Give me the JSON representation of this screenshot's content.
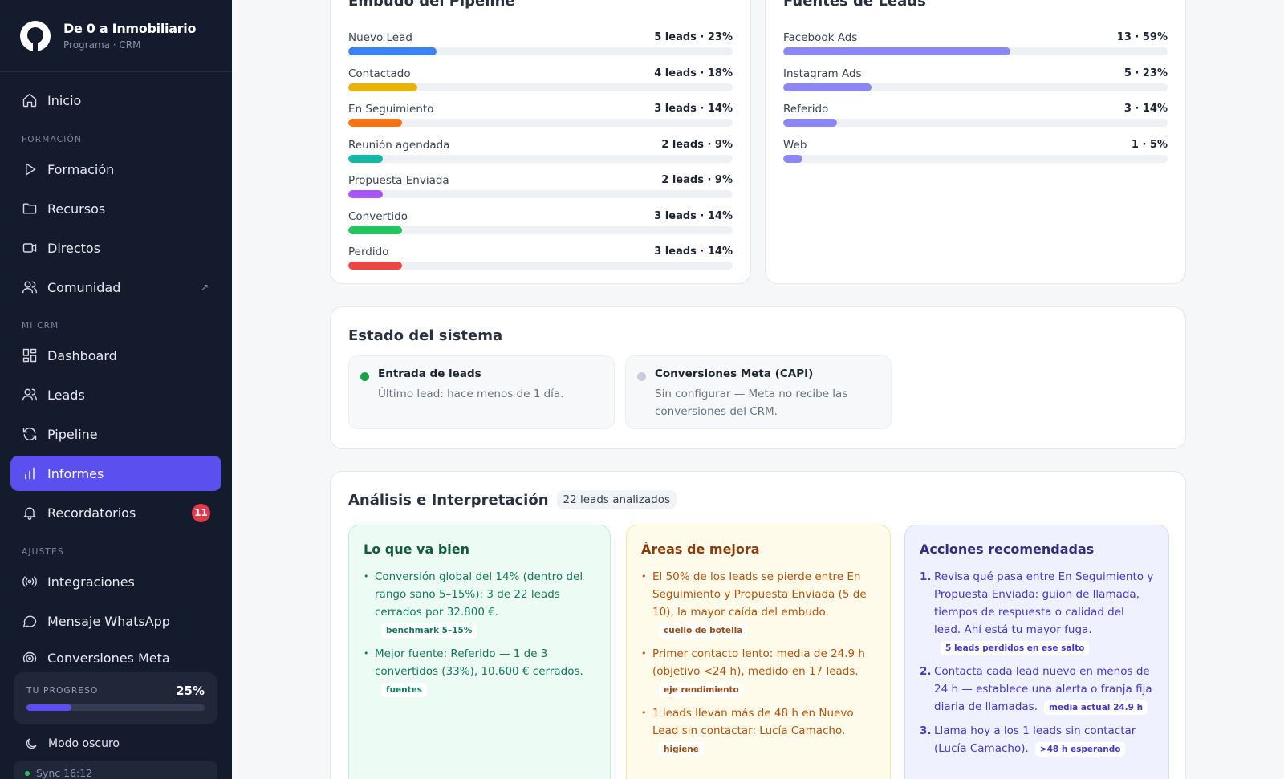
{
  "brand": {
    "title": "De 0 a Inmobiliario",
    "subtitle": "Programa · CRM"
  },
  "sidebar": {
    "home": "Inicio",
    "section_formacion": "FORMACIÓN",
    "formacion": "Formación",
    "recursos": "Recursos",
    "directos": "Directos",
    "comunidad": "Comunidad",
    "section_crm": "MI CRM",
    "dashboard": "Dashboard",
    "leads": "Leads",
    "pipeline": "Pipeline",
    "informes": "Informes",
    "recordatorios": "Recordatorios",
    "recordatorios_badge": "11",
    "section_ajustes": "AJUSTES",
    "integraciones": "Integraciones",
    "whatsapp": "Mensaje WhatsApp",
    "conversiones_meta": "Conversiones Meta"
  },
  "progress": {
    "label": "TU PROGRESO",
    "value": "25%",
    "fraction": 0.25
  },
  "dark_mode": "Modo oscuro",
  "sync": "Sync 16:12",
  "pipeline_card": {
    "title": "Embudo del Pipeline",
    "rows": [
      {
        "label": "Nuevo Lead",
        "value": "5 leads · 23%",
        "pct": 23,
        "color": "#3b82f6"
      },
      {
        "label": "Contactado",
        "value": "4 leads · 18%",
        "pct": 18,
        "color": "#eab308"
      },
      {
        "label": "En Seguimiento",
        "value": "3 leads · 14%",
        "pct": 14,
        "color": "#f97316"
      },
      {
        "label": "Reunión agendada",
        "value": "2 leads · 9%",
        "pct": 9,
        "color": "#14b8a6"
      },
      {
        "label": "Propuesta Enviada",
        "value": "2 leads · 9%",
        "pct": 9,
        "color": "#a855f7"
      },
      {
        "label": "Convertido",
        "value": "3 leads · 14%",
        "pct": 14,
        "color": "#22c55e"
      },
      {
        "label": "Perdido",
        "value": "3 leads · 14%",
        "pct": 14,
        "color": "#ef4444"
      }
    ]
  },
  "sources_card": {
    "title": "Fuentes de Leads",
    "rows": [
      {
        "label": "Facebook Ads",
        "value": "13 · 59%",
        "pct": 59,
        "color": "#8b87f5"
      },
      {
        "label": "Instagram Ads",
        "value": "5 · 23%",
        "pct": 23,
        "color": "#8b87f5"
      },
      {
        "label": "Referido",
        "value": "3 · 14%",
        "pct": 14,
        "color": "#8b87f5"
      },
      {
        "label": "Web",
        "value": "1 · 5%",
        "pct": 5,
        "color": "#8b87f5"
      }
    ]
  },
  "system": {
    "title": "Estado del sistema",
    "items": [
      {
        "title": "Entrada de leads",
        "desc": "Último lead: hace menos de 1 día.",
        "dot_color": "#16a34a"
      },
      {
        "title": "Conversiones Meta (CAPI)",
        "desc": "Sin configurar — Meta no recibe las conversiones del CRM.",
        "dot_color": "#c8cdd6"
      }
    ]
  },
  "analysis": {
    "title": "Análisis e Interpretación",
    "pill": "22 leads analizados",
    "good": {
      "title": "Lo que va bien",
      "items": [
        {
          "text": "Conversión global del 14% (dentro del rango sano 5–15%): 3 de 22 leads cerrados por 32.800 €.",
          "tag": "benchmark 5–15%"
        },
        {
          "text": "Mejor fuente: Referido — 1 de 3 convertidos (33%), 10.600 € cerrados.",
          "tag": "fuentes"
        }
      ]
    },
    "improve": {
      "title": "Áreas de mejora",
      "items": [
        {
          "text": "El 50% de los leads se pierde entre En Seguimiento y Propuesta Enviada (5 de 10), la mayor caída del embudo.",
          "tag": "cuello de botella"
        },
        {
          "text": "Primer contacto lento: media de 24.9 h (objetivo <24 h), medido en 17 leads.",
          "tag": "eje rendimiento"
        },
        {
          "text": "1 leads llevan más de 48 h en Nuevo Lead sin contactar: Lucía Camacho.",
          "tag": "higiene"
        }
      ]
    },
    "actions": {
      "title": "Acciones recomendadas",
      "items": [
        {
          "num": "1.",
          "text": "Revisa qué pasa entre En Seguimiento y Propuesta Enviada: guion de llamada, tiempos de respuesta o calidad del lead. Ahí está tu mayor fuga.",
          "tag": "5 leads perdidos en ese salto"
        },
        {
          "num": "2.",
          "text": "Contacta cada lead nuevo en menos de 24 h — establece una alerta o franja fija diaria de llamadas.",
          "tag": "media actual 24.9 h"
        },
        {
          "num": "3.",
          "text": "Llama hoy a los 1 leads sin contactar (Lucía Camacho).",
          "tag": ">48 h esperando"
        }
      ]
    }
  }
}
